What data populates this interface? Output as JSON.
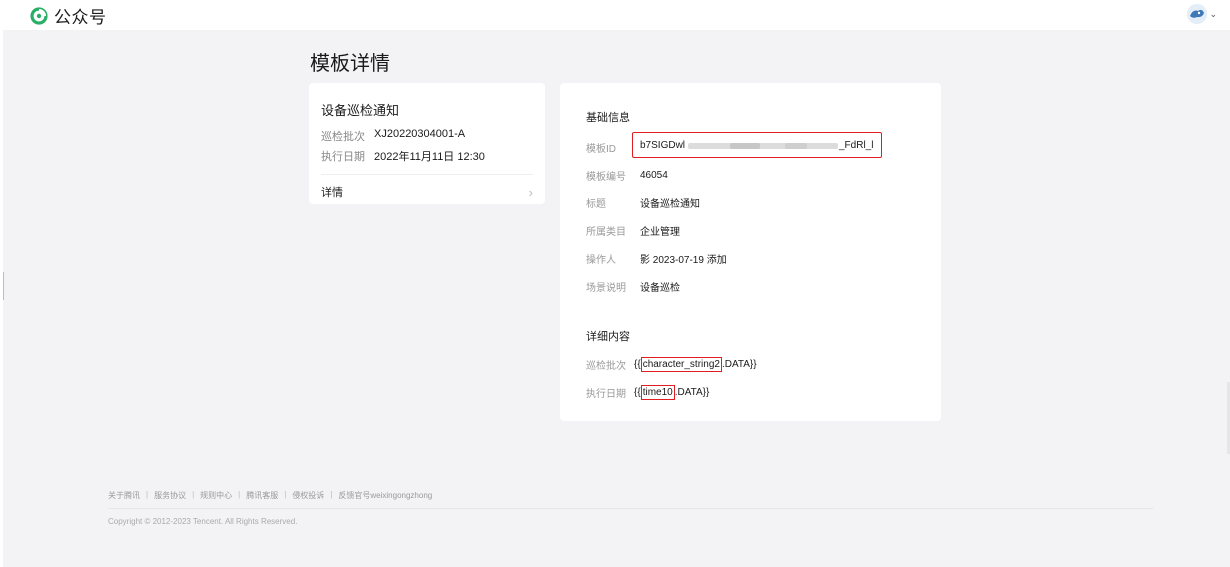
{
  "header": {
    "app_title": "公众号"
  },
  "page": {
    "title": "模板详情"
  },
  "preview": {
    "title": "设备巡检通知",
    "rows": [
      {
        "key": "巡检批次",
        "value": "XJ20220304001-A"
      },
      {
        "key": "执行日期",
        "value": "2022年11月11日 12:30"
      }
    ],
    "detail_label": "详情"
  },
  "basic_info": {
    "section_title": "基础信息",
    "template_id_label": "模板ID",
    "template_id_prefix": "b7SIGDwl",
    "template_id_suffix": "_FdRl_l",
    "rows": [
      {
        "key": "模板编号",
        "value": "46054"
      },
      {
        "key": "标题",
        "value": "设备巡检通知"
      },
      {
        "key": "所属类目",
        "value": "企业管理"
      },
      {
        "key": "操作人",
        "value": "影 2023-07-19 添加"
      },
      {
        "key": "场景说明",
        "value": "设备巡检"
      }
    ]
  },
  "detail_content": {
    "section_title": "详细内容",
    "rows": [
      {
        "key": "巡检批次",
        "open": "{{",
        "field": "character_string2",
        "close": ".DATA}}"
      },
      {
        "key": "执行日期",
        "open": "{{",
        "field": "time10",
        "close": ".DATA}}"
      }
    ]
  },
  "footer": {
    "links": [
      "关于腾讯",
      "服务协议",
      "规则中心",
      "腾讯客服",
      "侵权投诉",
      "反馈官号weixingongzhong"
    ],
    "copyright": "Copyright © 2012-2023 Tencent. All Rights Reserved."
  },
  "colors": {
    "brand_green": "#2aae67",
    "highlight_red": "#e02020",
    "page_gray": "#f3f3f5"
  }
}
